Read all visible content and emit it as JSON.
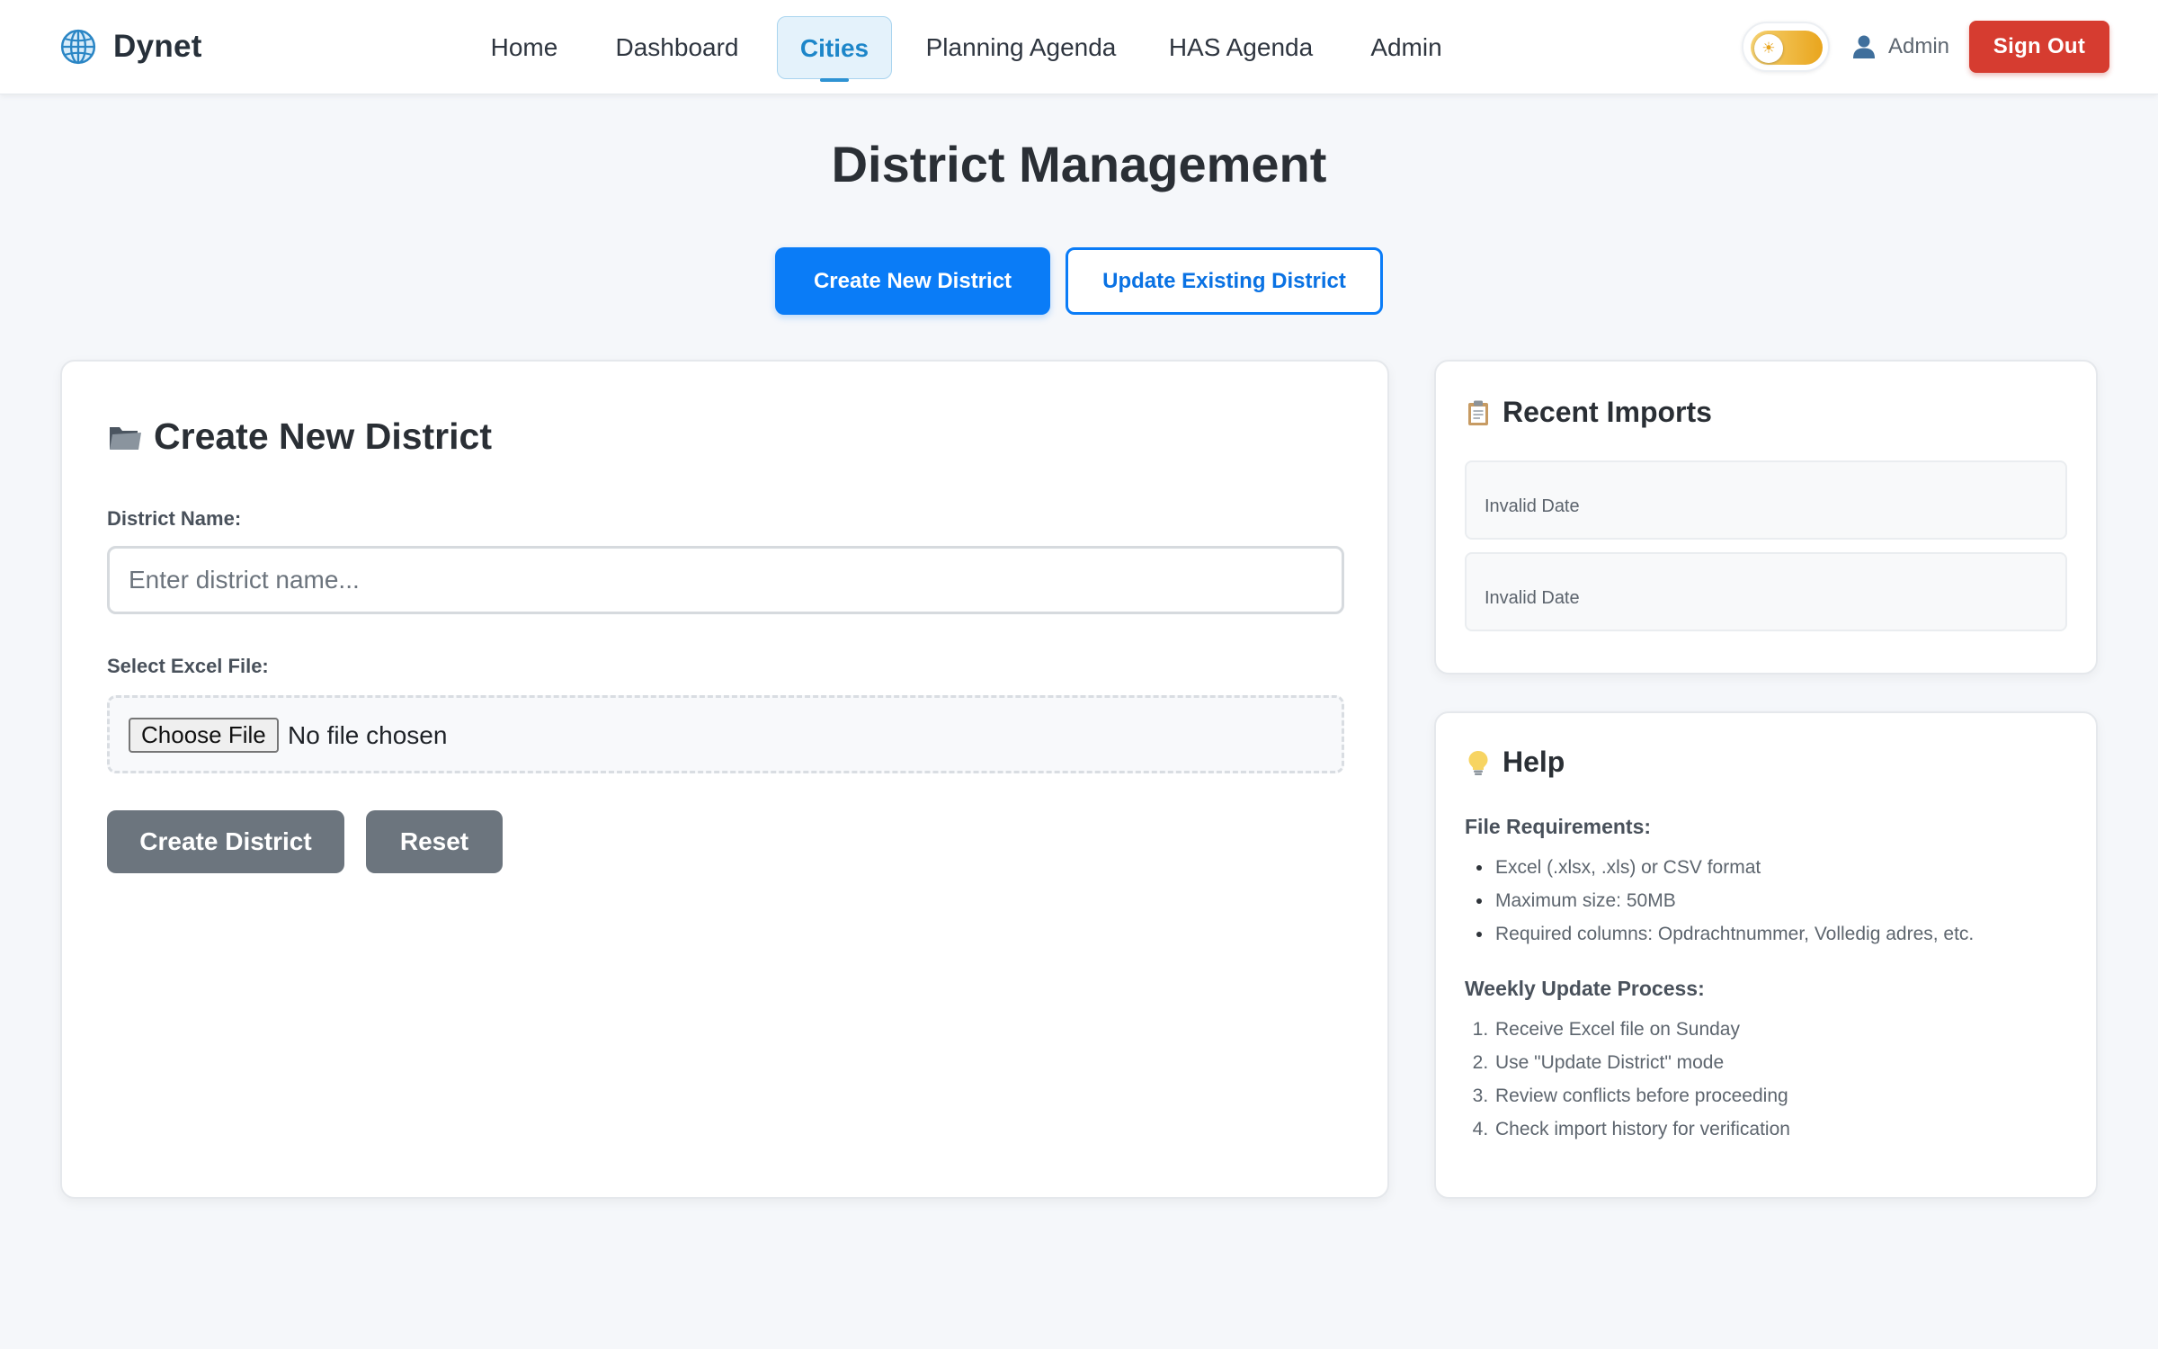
{
  "brand": {
    "name": "Dynet",
    "icon": "globe-icon"
  },
  "nav": {
    "links": [
      {
        "label": "Home"
      },
      {
        "label": "Dashboard"
      },
      {
        "label": "Cities",
        "active": true
      },
      {
        "label": "Planning Agenda"
      },
      {
        "label": "HAS Agenda"
      },
      {
        "label": "Admin"
      }
    ],
    "theme_toggle": {
      "icon": "sun-icon",
      "state": "light",
      "track_color": "#e9a51d"
    },
    "user": {
      "label": "Admin",
      "icon": "user-icon"
    },
    "sign_out_label": "Sign Out"
  },
  "page": {
    "title": "District Management"
  },
  "modes": {
    "create_label": "Create New District",
    "update_label": "Update Existing District",
    "active": "create"
  },
  "form": {
    "heading": "Create New District",
    "heading_icon": "folder-icon",
    "name_label": "District Name:",
    "name_placeholder": "Enter district name...",
    "name_value": "",
    "file_label": "Select Excel File:",
    "choose_file_label": "Choose File",
    "file_status": "No file chosen",
    "create_label": "Create District",
    "reset_label": "Reset"
  },
  "recent_imports": {
    "heading": "Recent Imports",
    "icon": "clipboard-icon",
    "items": [
      {
        "date": "Invalid Date"
      },
      {
        "date": "Invalid Date"
      }
    ]
  },
  "help": {
    "heading": "Help",
    "icon": "lightbulb-icon",
    "file_requirements_title": "File Requirements:",
    "file_requirements": [
      "Excel (.xlsx, .xls) or CSV format",
      "Maximum size: 50MB",
      "Required columns: Opdrachtnummer, Volledig adres, etc."
    ],
    "weekly_process_title": "Weekly Update Process:",
    "weekly_process": [
      "Receive Excel file on Sunday",
      "Use \"Update District\" mode",
      "Review conflicts before proceeding",
      "Check import history for verification"
    ]
  },
  "colors": {
    "primary": "#0a7cf7",
    "danger": "#d63c30",
    "nav_active": "#1d86c9",
    "secondary_button": "#6c757e",
    "page_background": "#f5f7fa"
  }
}
